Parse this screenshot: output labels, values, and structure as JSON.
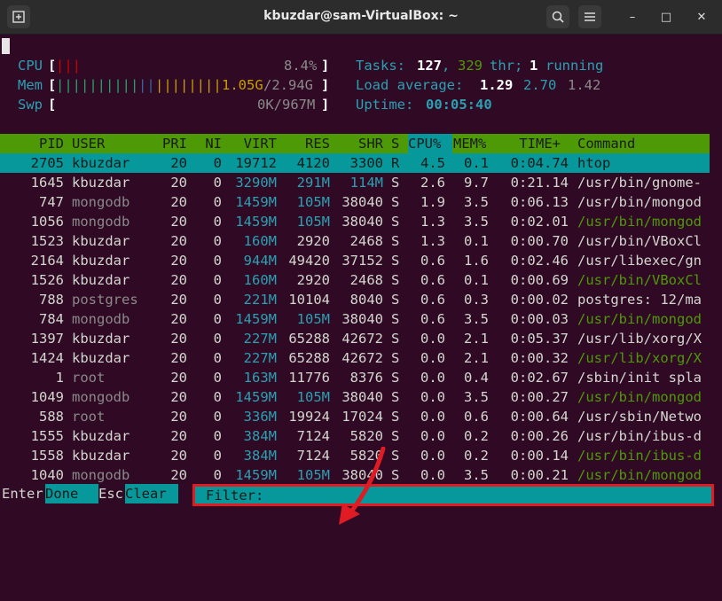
{
  "window": {
    "title": "kbuzdar@sam-VirtualBox: ~",
    "new_tab_icon": "new-tab-icon",
    "search_icon": "search-icon",
    "menu_icon": "hamburger-menu-icon",
    "minimize": "–",
    "maximize": "□",
    "close": "✕"
  },
  "meters": {
    "cpu_label": "CPU",
    "cpu_bars": "|||",
    "cpu_value": "8.4%",
    "mem_label": "Mem",
    "mem_bars_green": "||||||||||",
    "mem_bars_blue": "||",
    "mem_bars_orange": "||||||||",
    "mem_used": "1.05G",
    "mem_total": "/2.94G",
    "swp_label": "Swp",
    "swp_value": "0K/967M",
    "tasks_label": "Tasks:",
    "tasks_count": "127",
    "threads": "329",
    "thr_label": "thr;",
    "running_count": "1",
    "running_label": "running",
    "load_label": "Load average:",
    "load1": "1.29",
    "load5": "2.70",
    "load15": "1.42",
    "uptime_label": "Uptime:",
    "uptime": "00:05:40"
  },
  "columns": [
    "PID",
    "USER",
    "PRI",
    "NI",
    "VIRT",
    "RES",
    "SHR",
    "S",
    "CPU%",
    "MEM%",
    "TIME+",
    "Command"
  ],
  "processes": [
    {
      "pid": "2705",
      "user": "kbuzdar",
      "pri": "20",
      "ni": "0",
      "virt": "19712",
      "res": "4120",
      "shr": "3300",
      "s": "R",
      "cpu": "4.5",
      "mem": "0.1",
      "time": "0:04.74",
      "cmd": "htop",
      "selected": true
    },
    {
      "pid": "1645",
      "user": "kbuzdar",
      "pri": "20",
      "ni": "0",
      "virt": "3290M",
      "res": "291M",
      "shr": "114M",
      "s": "S",
      "cpu": "2.6",
      "mem": "9.7",
      "time": "0:21.14",
      "cmd": "/usr/bin/gnome-"
    },
    {
      "pid": "747",
      "user": "mongodb",
      "pri": "20",
      "ni": "0",
      "virt": "1459M",
      "res": "105M",
      "shr": "38040",
      "s": "S",
      "cpu": "1.9",
      "mem": "3.5",
      "time": "0:06.13",
      "cmd": "/usr/bin/mongod"
    },
    {
      "pid": "1056",
      "user": "mongodb",
      "pri": "20",
      "ni": "0",
      "virt": "1459M",
      "res": "105M",
      "shr": "38040",
      "s": "S",
      "cpu": "1.3",
      "mem": "3.5",
      "time": "0:02.01",
      "cmd": "/usr/bin/mongod",
      "thread": true
    },
    {
      "pid": "1523",
      "user": "kbuzdar",
      "pri": "20",
      "ni": "0",
      "virt": "160M",
      "res": "2920",
      "shr": "2468",
      "s": "S",
      "cpu": "1.3",
      "mem": "0.1",
      "time": "0:00.70",
      "cmd": "/usr/bin/VBoxCl"
    },
    {
      "pid": "2164",
      "user": "kbuzdar",
      "pri": "20",
      "ni": "0",
      "virt": "944M",
      "res": "49420",
      "shr": "37152",
      "s": "S",
      "cpu": "0.6",
      "mem": "1.6",
      "time": "0:02.46",
      "cmd": "/usr/libexec/gn"
    },
    {
      "pid": "1526",
      "user": "kbuzdar",
      "pri": "20",
      "ni": "0",
      "virt": "160M",
      "res": "2920",
      "shr": "2468",
      "s": "S",
      "cpu": "0.6",
      "mem": "0.1",
      "time": "0:00.69",
      "cmd": "/usr/bin/VBoxCl",
      "thread": true
    },
    {
      "pid": "788",
      "user": "postgres",
      "pri": "20",
      "ni": "0",
      "virt": "221M",
      "res": "10104",
      "shr": "8040",
      "s": "S",
      "cpu": "0.6",
      "mem": "0.3",
      "time": "0:00.02",
      "cmd": "postgres: 12/ma"
    },
    {
      "pid": "784",
      "user": "mongodb",
      "pri": "20",
      "ni": "0",
      "virt": "1459M",
      "res": "105M",
      "shr": "38040",
      "s": "S",
      "cpu": "0.6",
      "mem": "3.5",
      "time": "0:00.03",
      "cmd": "/usr/bin/mongod",
      "thread": true
    },
    {
      "pid": "1397",
      "user": "kbuzdar",
      "pri": "20",
      "ni": "0",
      "virt": "227M",
      "res": "65288",
      "shr": "42672",
      "s": "S",
      "cpu": "0.0",
      "mem": "2.1",
      "time": "0:05.37",
      "cmd": "/usr/lib/xorg/X"
    },
    {
      "pid": "1424",
      "user": "kbuzdar",
      "pri": "20",
      "ni": "0",
      "virt": "227M",
      "res": "65288",
      "shr": "42672",
      "s": "S",
      "cpu": "0.0",
      "mem": "2.1",
      "time": "0:00.32",
      "cmd": "/usr/lib/xorg/X",
      "thread": true
    },
    {
      "pid": "1",
      "user": "root",
      "pri": "20",
      "ni": "0",
      "virt": "163M",
      "res": "11776",
      "shr": "8376",
      "s": "S",
      "cpu": "0.0",
      "mem": "0.4",
      "time": "0:02.67",
      "cmd": "/sbin/init spla"
    },
    {
      "pid": "1049",
      "user": "mongodb",
      "pri": "20",
      "ni": "0",
      "virt": "1459M",
      "res": "105M",
      "shr": "38040",
      "s": "S",
      "cpu": "0.0",
      "mem": "3.5",
      "time": "0:00.27",
      "cmd": "/usr/bin/mongod",
      "thread": true
    },
    {
      "pid": "588",
      "user": "root",
      "pri": "20",
      "ni": "0",
      "virt": "336M",
      "res": "19924",
      "shr": "17024",
      "s": "S",
      "cpu": "0.0",
      "mem": "0.6",
      "time": "0:00.64",
      "cmd": "/usr/sbin/Netwo"
    },
    {
      "pid": "1555",
      "user": "kbuzdar",
      "pri": "20",
      "ni": "0",
      "virt": "384M",
      "res": "7124",
      "shr": "5820",
      "s": "S",
      "cpu": "0.0",
      "mem": "0.2",
      "time": "0:00.26",
      "cmd": "/usr/bin/ibus-d"
    },
    {
      "pid": "1558",
      "user": "kbuzdar",
      "pri": "20",
      "ni": "0",
      "virt": "384M",
      "res": "7124",
      "shr": "5820",
      "s": "S",
      "cpu": "0.0",
      "mem": "0.2",
      "time": "0:00.14",
      "cmd": "/usr/bin/ibus-d",
      "thread": true
    },
    {
      "pid": "1040",
      "user": "mongodb",
      "pri": "20",
      "ni": "0",
      "virt": "1459M",
      "res": "105M",
      "shr": "38040",
      "s": "S",
      "cpu": "0.0",
      "mem": "3.5",
      "time": "0:00.21",
      "cmd": "/usr/bin/mongod",
      "thread": true
    }
  ],
  "footer": {
    "enter_key": "Enter",
    "enter_label": "Done",
    "esc_key": "Esc",
    "esc_label": "Clear",
    "filter_label": "Filter:",
    "filter_value": ""
  },
  "colors": {
    "terminal_bg": "#300a24",
    "header_bg": "#4e9a06",
    "selection_bg": "#06989a",
    "highlight_box": "#e01b24"
  }
}
